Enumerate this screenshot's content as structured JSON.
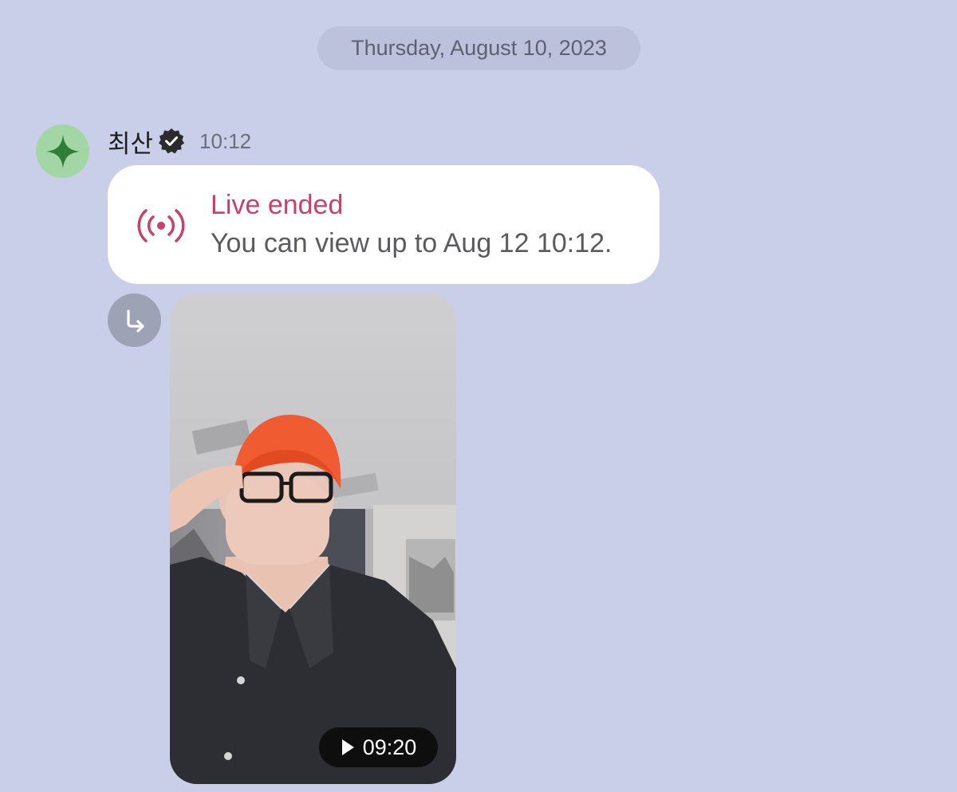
{
  "chat": {
    "date_separator": "Thursday, August 10, 2023",
    "message": {
      "sender_name": "최산",
      "sender_verified": true,
      "time": "10:12",
      "avatar_icon": "sparkle-icon",
      "live_card": {
        "title": "Live ended",
        "description": "You can view up to Aug 12 10:12.",
        "icon": "broadcast-icon",
        "accent_color": "#c8416a"
      },
      "video": {
        "duration": "09:20",
        "play_icon": "play-icon"
      },
      "share_icon": "share-arrow-icon"
    }
  },
  "colors": {
    "background": "#cacfe9",
    "bubble": "#ffffff",
    "avatar_bg": "#a3d6a5",
    "avatar_star": "#2e7d3b"
  }
}
